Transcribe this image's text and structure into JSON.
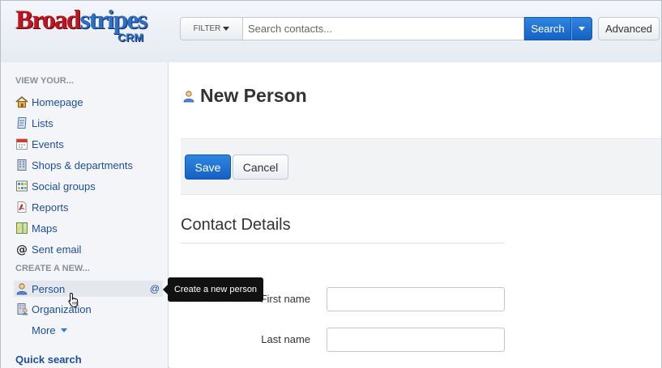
{
  "brand": {
    "name_part1": "Broad",
    "name_part2": "stripes",
    "sub": "CRM"
  },
  "search": {
    "filter_label": "FILTER",
    "placeholder": "Search contacts...",
    "search_label": "Search",
    "advanced_label": "Advanced"
  },
  "sidebar": {
    "view_heading": "VIEW YOUR...",
    "view_items": [
      {
        "label": "Homepage",
        "icon": "house-icon"
      },
      {
        "label": "Lists",
        "icon": "list-icon"
      },
      {
        "label": "Events",
        "icon": "calendar-icon"
      },
      {
        "label": "Shops & departments",
        "icon": "building-icon"
      },
      {
        "label": "Social groups",
        "icon": "grid-icon"
      },
      {
        "label": "Reports",
        "icon": "pdf-icon"
      },
      {
        "label": "Maps",
        "icon": "map-icon"
      },
      {
        "label": "Sent email",
        "icon": "at-icon"
      }
    ],
    "create_heading": "CREATE A NEW...",
    "create_items": [
      {
        "label": "Person",
        "icon": "person-icon",
        "extra": "@"
      },
      {
        "label": "Organization",
        "icon": "organization-icon"
      }
    ],
    "more_label": "More",
    "quick_search": "Quick search"
  },
  "tooltip": {
    "text": "Create a new person"
  },
  "main": {
    "title": "New Person",
    "save_label": "Save",
    "cancel_label": "Cancel",
    "section_title": "Contact Details",
    "fields": [
      {
        "label": "First name",
        "value": ""
      },
      {
        "label": "Last name",
        "value": ""
      }
    ]
  },
  "colors": {
    "brand_red": "#c0141f",
    "brand_blue": "#2f6fc6",
    "link_blue": "#1d4e9e",
    "primary_button": "#1f6fd2"
  }
}
